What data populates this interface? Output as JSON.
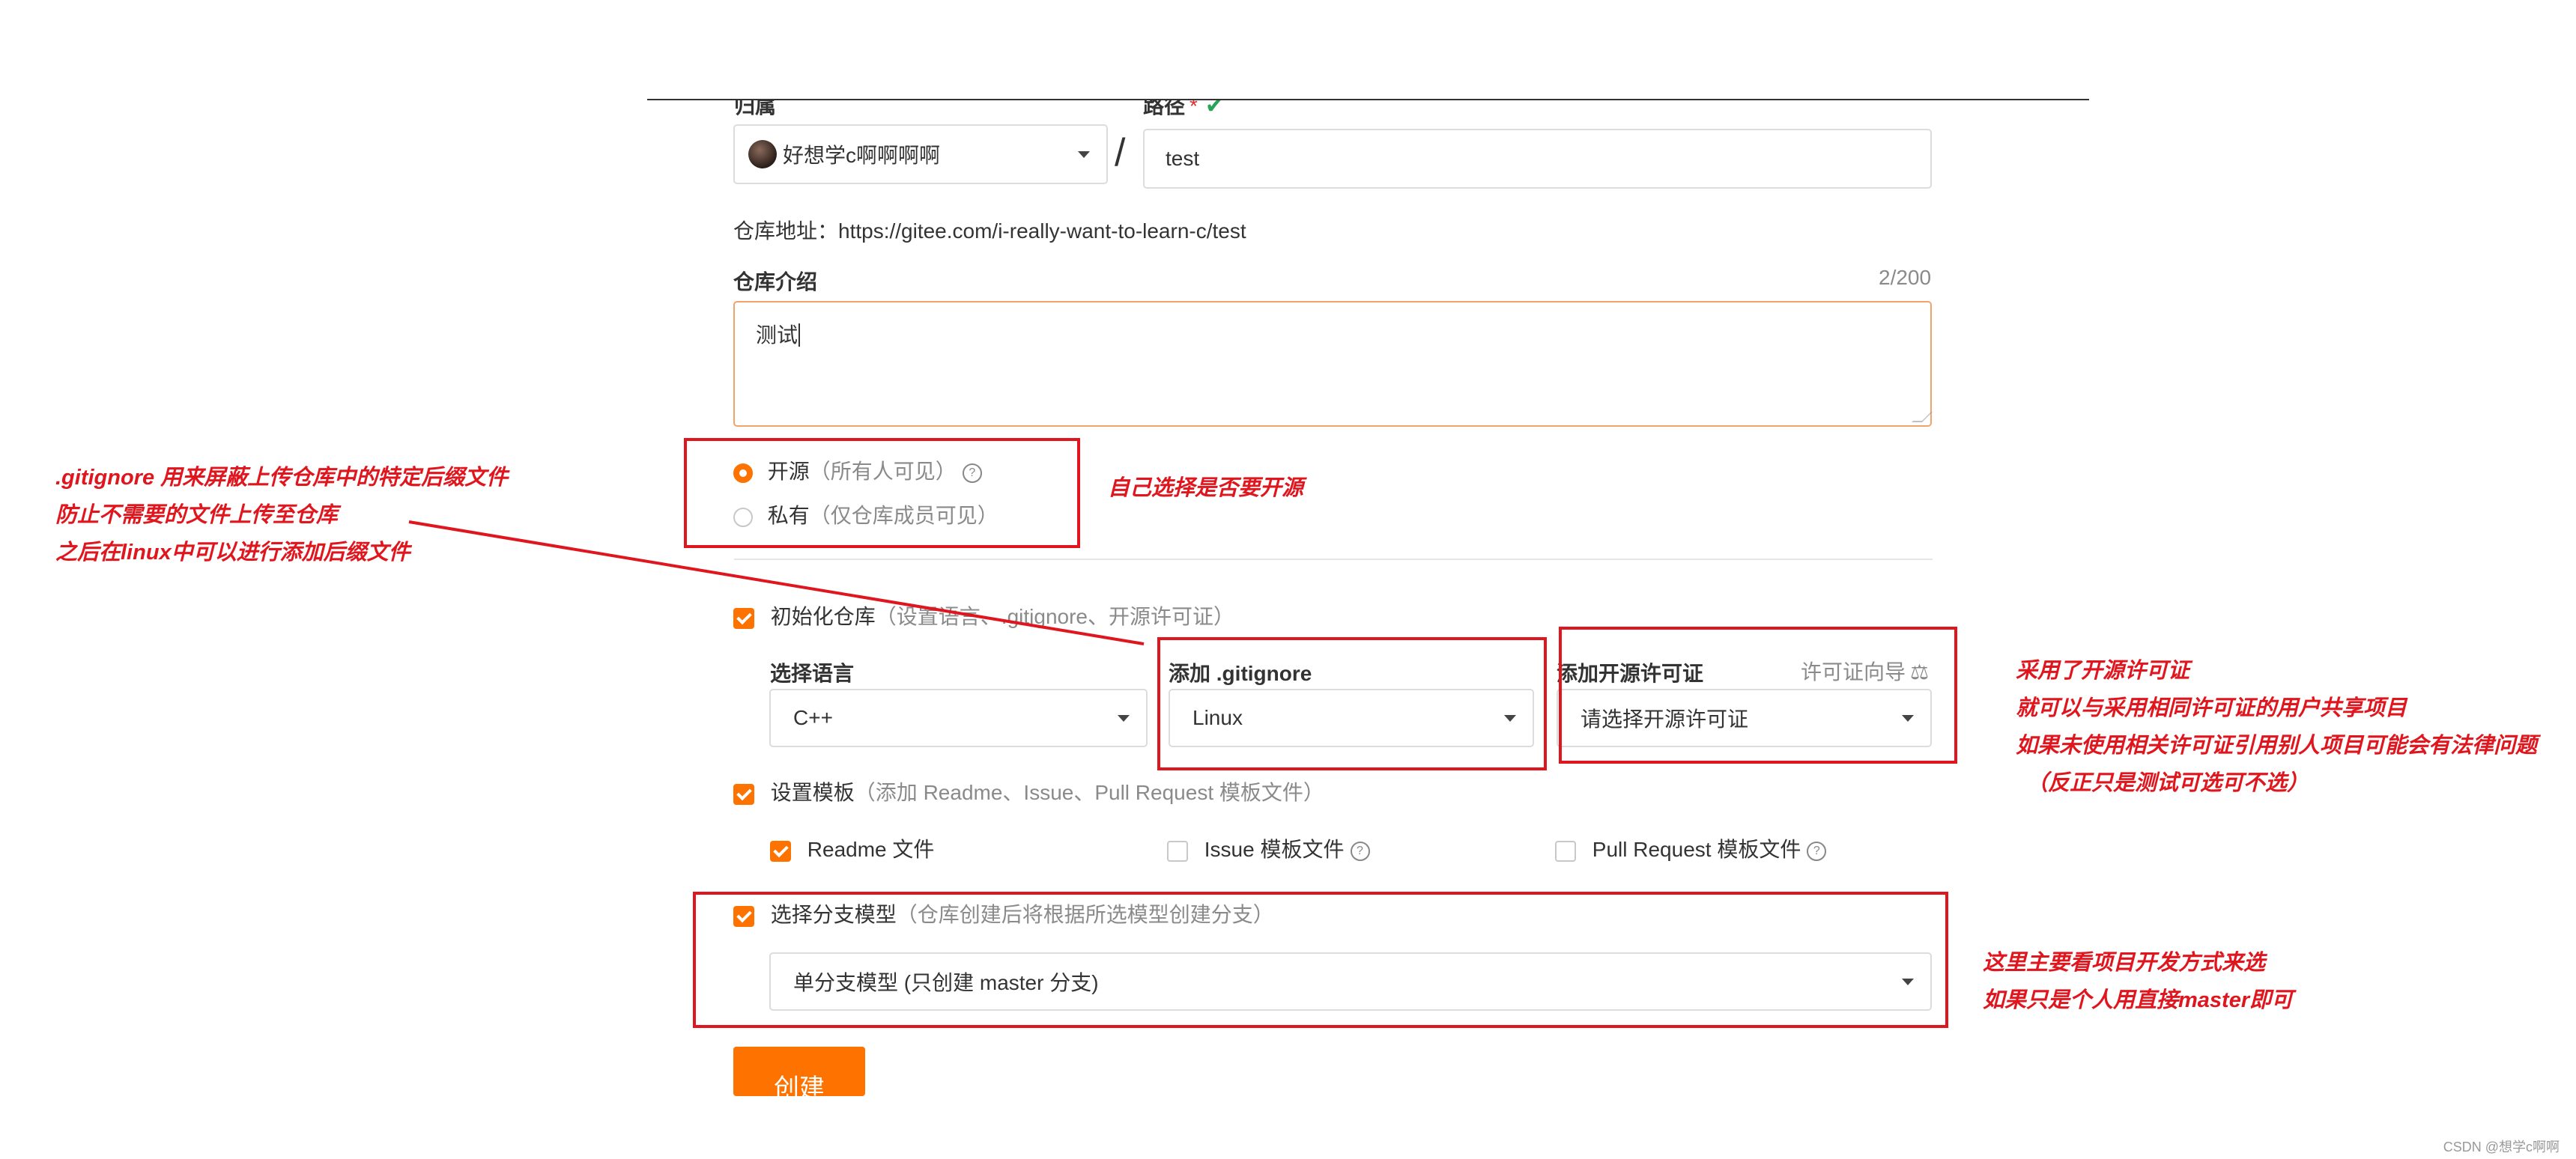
{
  "form": {
    "owner_label": "归属",
    "path_label": "路径",
    "required_mark": "*",
    "owner_value": "好想学c啊啊啊啊",
    "slash": "/",
    "path_value": "test",
    "repo_url_text": "仓库地址：https://gitee.com/i-really-want-to-learn-c/test",
    "intro_label": "仓库介绍",
    "intro_count": "2/200",
    "intro_value": "测试",
    "visibility": {
      "public_label": "开源",
      "public_hint": "（所有人可见）",
      "private_label": "私有",
      "private_hint": "（仅仓库成员可见）"
    },
    "init_repo_label": "初始化仓库",
    "init_repo_hint": "（设置语言、.gitignore、开源许可证）",
    "language_label": "选择语言",
    "language_value": "C++",
    "gitignore_label": "添加 .gitignore",
    "gitignore_value": "Linux",
    "license_label": "添加开源许可证",
    "license_wizard": "许可证向导",
    "license_value": "请选择开源许可证",
    "template_label": "设置模板",
    "template_hint": "（添加 Readme、Issue、Pull Request 模板文件）",
    "readme_label": "Readme 文件",
    "issue_label": "Issue 模板文件",
    "pr_label": "Pull Request 模板文件",
    "branch_label": "选择分支模型",
    "branch_hint": "（仓库创建后将根据所选模型创建分支）",
    "branch_value": "单分支模型 (只创建 master 分支)",
    "create_button": "创建"
  },
  "annotations": {
    "gitignore_note": [
      ".gitignore 用来屏蔽上传仓库中的特定后缀文件",
      "防止不需要的文件上传至仓库",
      "之后在linux中可以进行添加后缀文件"
    ],
    "visibility_note": "自己选择是否要开源",
    "license_note": [
      "采用了开源许可证",
      "就可以与采用相同许可证的用户共享项目",
      "如果未使用相关许可证引用别人项目可能会有法律问题",
      "（反正只是测试可选可不选）"
    ],
    "branch_note": [
      "这里主要看项目开发方式来选",
      "如果只是个人用直接master即可"
    ]
  },
  "watermark": "CSDN @想学c啊啊",
  "colors": {
    "accent": "#fe7300",
    "annotation_red": "#e0161e",
    "check_green": "#27a35a"
  }
}
